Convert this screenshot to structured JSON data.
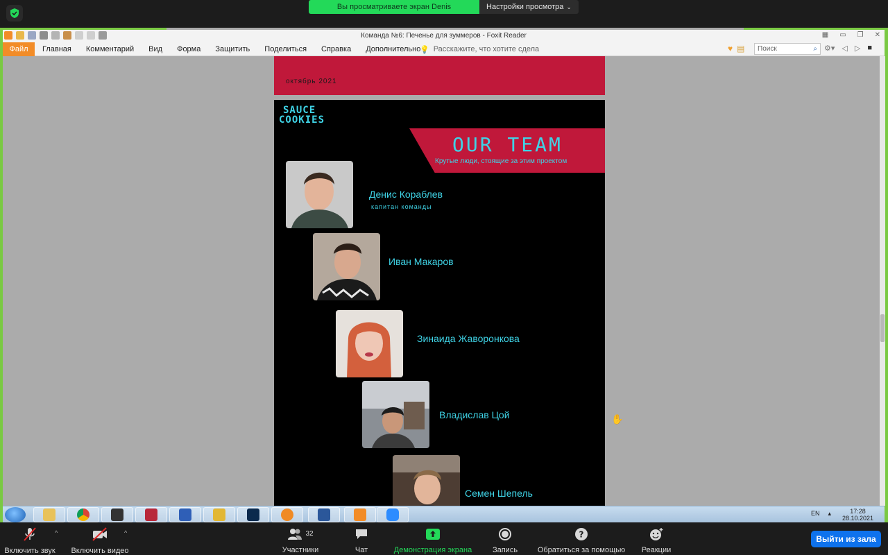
{
  "zoom": {
    "share_banner": "Вы просматриваете экран Denis",
    "view_options": "Настройки просмотра",
    "toolbar": {
      "unmute": "Включить звук",
      "start_video": "Включить видео",
      "participants": "Участники",
      "participants_count": "32",
      "chat": "Чат",
      "share_screen": "Демонстрация экрана",
      "record": "Запись",
      "ask_for_help": "Обратиться за помощью",
      "reactions": "Реакции",
      "leave": "Выйти из зала"
    },
    "colors": {
      "green": "#23d959",
      "blue": "#0e72ed"
    }
  },
  "foxit": {
    "title": "Команда №6: Печенье для зуммеров - Foxit Reader",
    "menu": {
      "file": "Файл",
      "items": [
        "Главная",
        "Комментарий",
        "Вид",
        "Форма",
        "Защитить",
        "Поделиться",
        "Справка",
        "Дополнительно"
      ]
    },
    "tell_me_placeholder": "Расскажите, что хотите сдела",
    "search_placeholder": "Поиск"
  },
  "document": {
    "date": "октябрь 2021",
    "logo_line1": "SAUCE",
    "logo_line2": "COOKIES",
    "heading": "OUR TEAM",
    "subheading": "Крутые люди, стоящие за этим проектом",
    "members": [
      {
        "name": "Денис Кораблев",
        "role": "капитан команды"
      },
      {
        "name": "Иван Макаров",
        "role": ""
      },
      {
        "name": "Зинаида Жаворонкова",
        "role": ""
      },
      {
        "name": "Владислав Цой",
        "role": ""
      },
      {
        "name": "Семен Шепель",
        "role": ""
      }
    ],
    "colors": {
      "accent": "#c0183a",
      "cyan": "#3fd3e6"
    }
  },
  "taskbar": {
    "language": "EN",
    "time": "17:28",
    "date": "28.10.2021"
  }
}
